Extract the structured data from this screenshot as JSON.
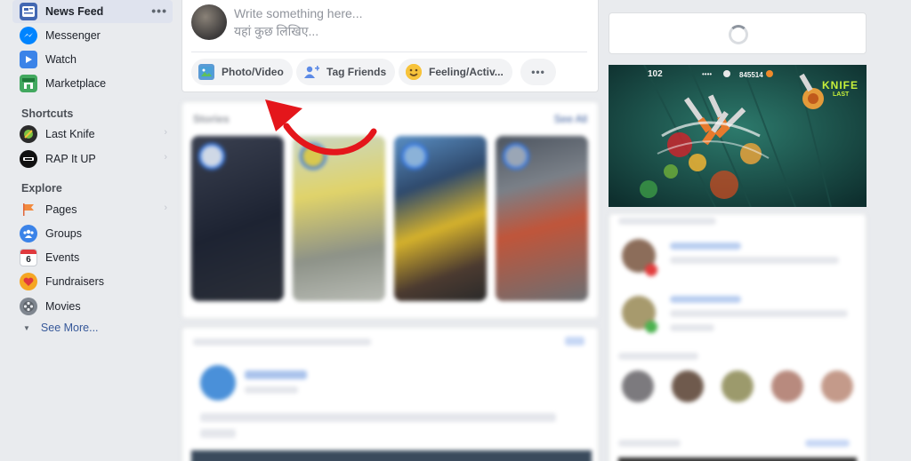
{
  "sidebar": {
    "news_feed": "News Feed",
    "more_dots": "•••",
    "items": [
      {
        "label": "Messenger",
        "icon": "messenger-icon"
      },
      {
        "label": "Watch",
        "icon": "watch-icon"
      },
      {
        "label": "Marketplace",
        "icon": "marketplace-icon"
      }
    ],
    "shortcuts_heading": "Shortcuts",
    "shortcuts": [
      {
        "label": "Last Knife",
        "icon": "last-knife-icon"
      },
      {
        "label": "RAP It UP",
        "icon": "rap-it-up-icon"
      }
    ],
    "explore_heading": "Explore",
    "explore": [
      {
        "label": "Pages",
        "icon": "pages-flag-icon"
      },
      {
        "label": "Groups",
        "icon": "groups-icon"
      },
      {
        "label": "Events",
        "icon": "events-calendar-icon",
        "icon_text": "6"
      },
      {
        "label": "Fundraisers",
        "icon": "fundraisers-heart-icon"
      },
      {
        "label": "Movies",
        "icon": "movies-reel-icon"
      }
    ],
    "see_more": "See More..."
  },
  "composer": {
    "placeholder_en": "Write something here...",
    "placeholder_hi": "यहां कुछ लिखिए...",
    "actions": {
      "photo_video": "Photo/Video",
      "tag_friends": "Tag Friends",
      "feeling": "Feeling/Activ...",
      "more": "•••"
    }
  },
  "stories": {
    "title": "Stories",
    "see_all": "See All"
  },
  "game_ad": {
    "score": "102",
    "coins": "845514",
    "logo_line1": "KNIFE",
    "logo_line2": "LAST"
  },
  "colors": {
    "fb_blue": "#4267b2",
    "link": "#365899",
    "annotation_arrow": "#e4161b",
    "page_bg": "#e9ebee"
  }
}
